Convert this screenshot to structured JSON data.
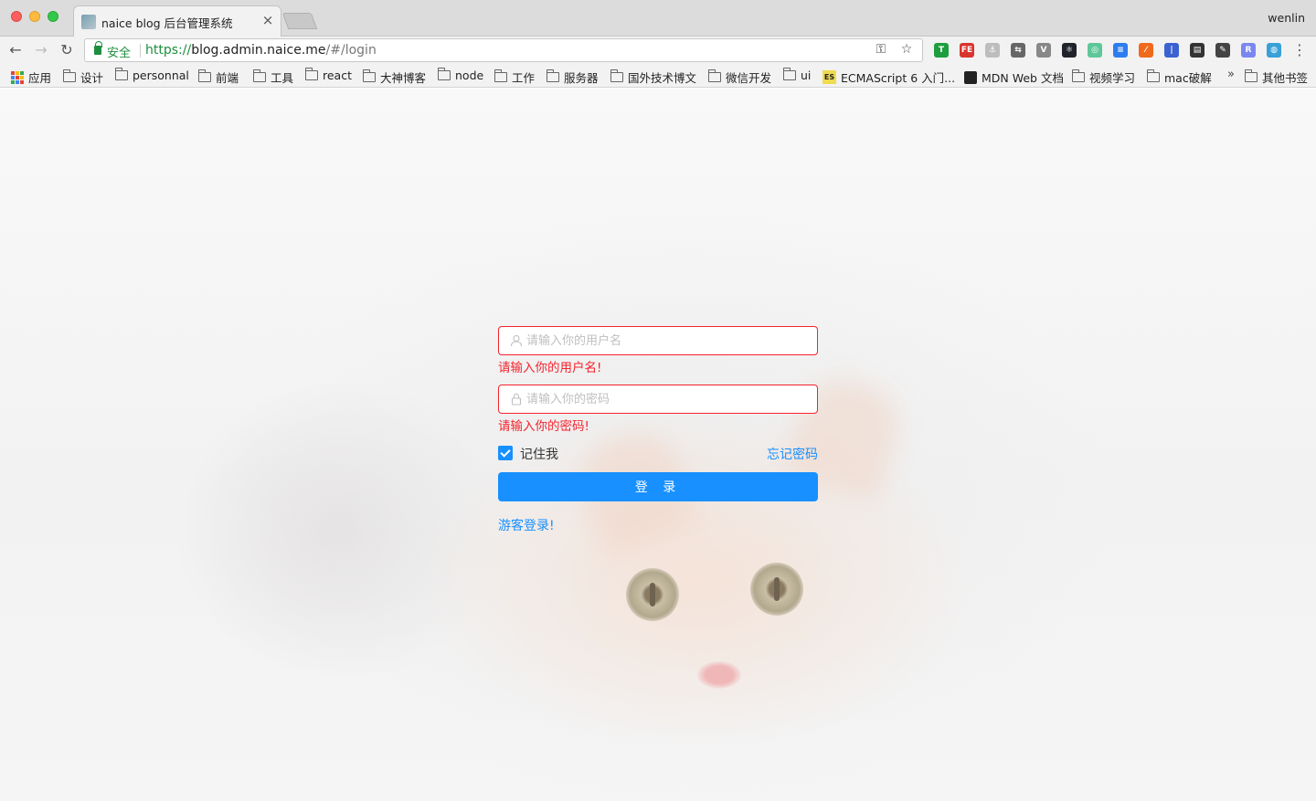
{
  "window": {
    "tab_title": "naice blog 后台管理系统",
    "profile": "wenlin",
    "tab_close": "×"
  },
  "toolbar": {
    "secure_label": "安全",
    "url_scheme": "https://",
    "url_host": "blog.admin.naice.me",
    "url_path": "/#/login",
    "back_glyph": "←",
    "forward_glyph": "→",
    "reload_glyph": "↻",
    "key_glyph": "⚿",
    "star_glyph": "☆",
    "menu_glyph": "⋮"
  },
  "extensions": [
    {
      "name": "shield",
      "color": "#1e9e3e",
      "glyph": "T"
    },
    {
      "name": "fe",
      "color": "#d9352f",
      "glyph": "FE"
    },
    {
      "name": "pin",
      "color": "#bdbdbd",
      "glyph": "⚓"
    },
    {
      "name": "link",
      "color": "#666666",
      "glyph": "⇆"
    },
    {
      "name": "vue",
      "color": "#888888",
      "glyph": "V"
    },
    {
      "name": "react",
      "color": "#20232a",
      "glyph": "⚛"
    },
    {
      "name": "color",
      "color": "#5ec79a",
      "glyph": "◎"
    },
    {
      "name": "inbox",
      "color": "#2e7df0",
      "glyph": "≡"
    },
    {
      "name": "xp",
      "color": "#f06a1c",
      "glyph": "⁄"
    },
    {
      "name": "ruler",
      "color": "#3a62d1",
      "glyph": "|"
    },
    {
      "name": "octotree",
      "color": "#333333",
      "glyph": "▤"
    },
    {
      "name": "evernote",
      "color": "#444444",
      "glyph": "✎"
    },
    {
      "name": "r",
      "color": "#7b87f0",
      "glyph": "R"
    },
    {
      "name": "globe",
      "color": "#3aa0d8",
      "glyph": "◍"
    }
  ],
  "bookmarks": {
    "apps": "应用",
    "items": [
      "设计",
      "personnal",
      "前端",
      "工具",
      "react",
      "大神博客",
      "node",
      "工作",
      "服务器",
      "国外技术博文",
      "微信开发",
      "ui"
    ],
    "es": {
      "badge": "ES",
      "label": "ECMAScript 6 入门..."
    },
    "mdn": "MDN Web 文档",
    "items2": [
      "视频学习",
      "mac破解"
    ],
    "more": "»",
    "other": "其他书签"
  },
  "login": {
    "username_placeholder": "请输入你的用户名",
    "username_value": "",
    "username_error": "请输入你的用户名!",
    "password_placeholder": "请输入你的密码",
    "password_value": "",
    "password_error": "请输入你的密码!",
    "remember_label": "记住我",
    "remember_checked": true,
    "forgot_label": "忘记密码",
    "submit_label": "登 录",
    "guest_label": "游客登录!"
  },
  "colors": {
    "primary": "#1890ff",
    "error": "#f5222d",
    "secure": "#1e8e3e"
  }
}
